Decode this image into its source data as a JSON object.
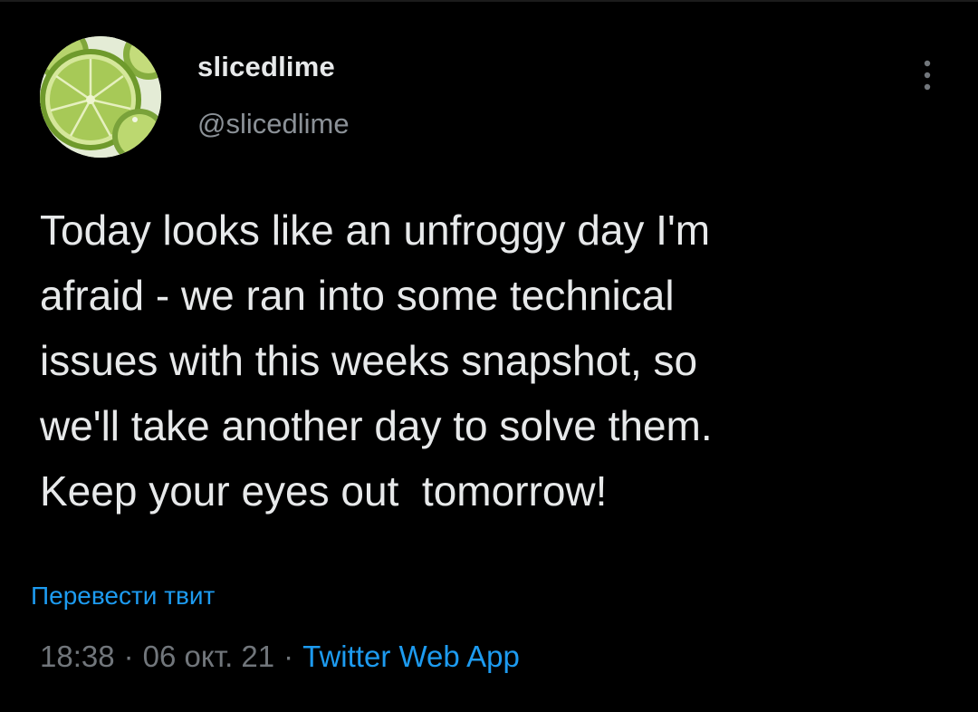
{
  "user": {
    "display_name": "slicedlime",
    "handle": "@slicedlime"
  },
  "tweet": {
    "lines": [
      "Today looks like an unfroggy day I'm",
      "afraid - we ran into some technical",
      "issues with this weeks snapshot, so",
      "we'll take another day to solve them.",
      "Keep your eyes out  tomorrow!"
    ]
  },
  "translate_label": "Перевести твит",
  "meta": {
    "time": "18:38",
    "date": "06 окт. 21",
    "source": "Twitter Web App",
    "separator": "·"
  },
  "colors": {
    "background": "#000000",
    "text": "#e7e9ea",
    "secondary": "#71767b",
    "link": "#1d9bf0"
  },
  "icons": {
    "more": "more-vertical-icon",
    "avatar": "lime-slice-avatar"
  }
}
